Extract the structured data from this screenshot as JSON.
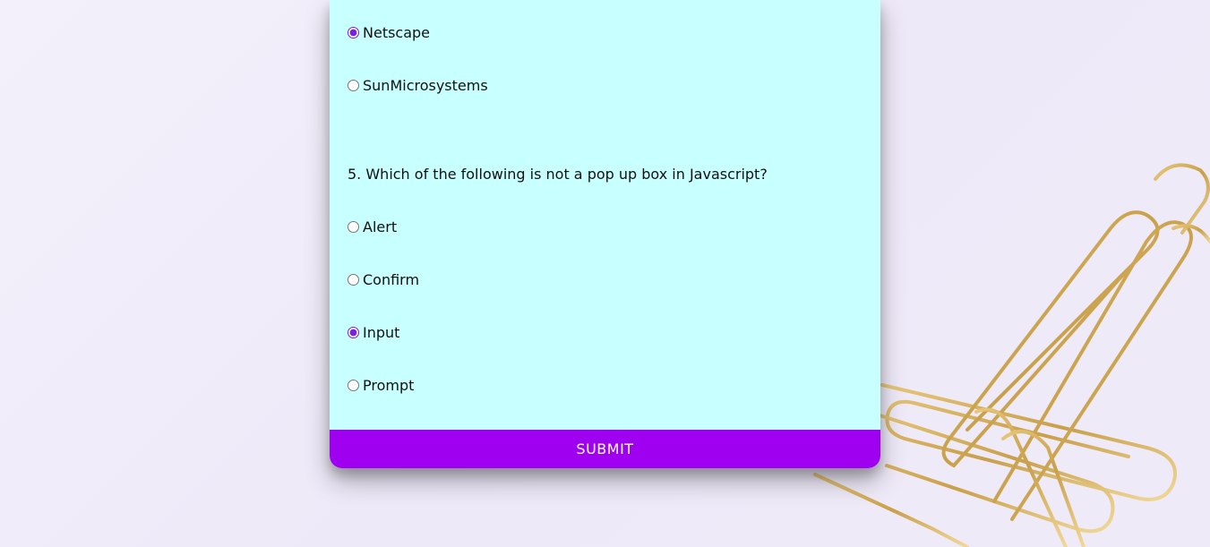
{
  "quiz": {
    "q4_options": [
      {
        "label": "Netscape",
        "checked": true
      },
      {
        "label": "SunMicrosystems",
        "checked": false
      }
    ],
    "q5": {
      "question": "5. Which of the following is not a pop up box in Javascript?",
      "options": [
        {
          "label": "Alert",
          "checked": false
        },
        {
          "label": "Confirm",
          "checked": false
        },
        {
          "label": "Input",
          "checked": true
        },
        {
          "label": "Prompt",
          "checked": false
        }
      ]
    },
    "submit_label": "SUBMIT"
  },
  "colors": {
    "card_bg": "#c8ffff",
    "submit_bg": "#a000f0",
    "accent": "#7b1fe0"
  }
}
